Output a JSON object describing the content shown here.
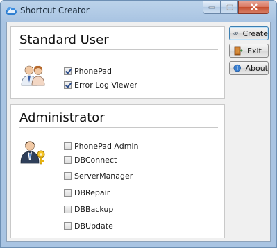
{
  "window": {
    "title": "Shortcut Creator"
  },
  "standard_user": {
    "heading": "Standard User",
    "options": [
      {
        "label": "PhonePad",
        "checked": true
      },
      {
        "label": "Error Log Viewer",
        "checked": true
      }
    ]
  },
  "administrator": {
    "heading": "Administrator",
    "options": [
      {
        "label": "PhonePad Admin",
        "checked": false
      },
      {
        "label": "DBConnect",
        "checked": false
      },
      {
        "label": "ServerManager",
        "checked": false
      },
      {
        "label": "DBRepair",
        "checked": false
      },
      {
        "label": "DBBackup",
        "checked": false
      },
      {
        "label": "DBUpdate",
        "checked": false
      }
    ]
  },
  "buttons": {
    "create": "Create",
    "exit": "Exit",
    "about": "About"
  },
  "icons": {
    "app": "cloud-app-icon",
    "standard_group": "users-icon",
    "admin_group": "admin-key-icon",
    "create": "link-icon",
    "exit": "door-exit-icon",
    "about": "info-icon"
  }
}
